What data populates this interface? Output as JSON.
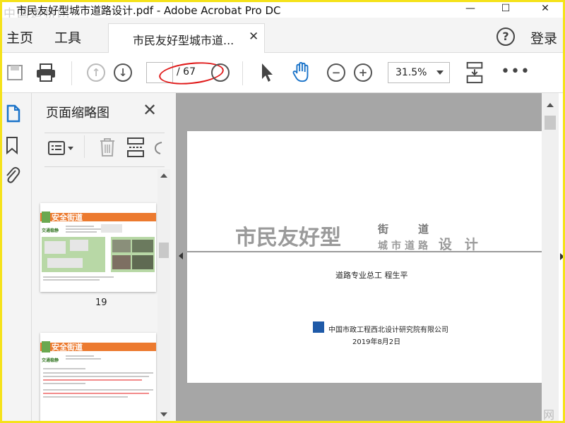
{
  "window": {
    "title": "市民友好型城市道路设计.pdf - Adobe Acrobat Pro DC",
    "watermark": "中国道桥网",
    "corner_watermark": "网"
  },
  "tabs": {
    "home": "主页",
    "tools": "工具",
    "document": "市民友好型城市道...",
    "help": "?",
    "login": "登录"
  },
  "toolbar": {
    "page_current": "",
    "page_total": "/ 67",
    "zoom": "31.5%",
    "annotation_color": "#e01b1b"
  },
  "panel": {
    "title": "页面缩略图",
    "thumbnails": [
      {
        "header": "安全街道",
        "tag": "交通稳静",
        "page_label": "19"
      },
      {
        "header": "安全街道",
        "tag": "交通稳静",
        "page_label": ""
      }
    ]
  },
  "document": {
    "title_main": "市民友好型",
    "title_right_top": "街道",
    "title_right_small": "城市道路",
    "title_right_big": "设计",
    "author": "道路专业总工   程生平",
    "organization": "中国市政工程西北设计研究院有限公司",
    "date": "2019年8月2日"
  },
  "colors": {
    "accent_orange": "#ec7a2f",
    "highlight_border": "#f5e21a",
    "active_blue": "#1a73c9"
  }
}
